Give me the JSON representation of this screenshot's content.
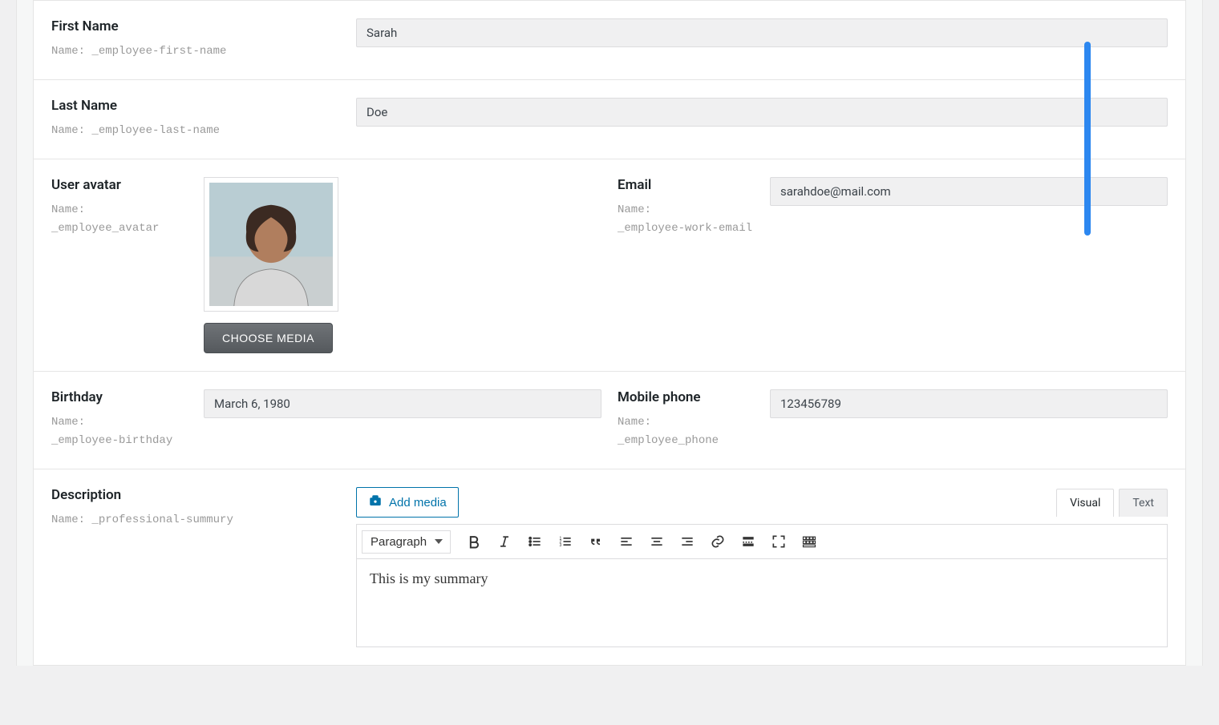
{
  "fields": {
    "firstName": {
      "label": "First Name",
      "namePrefix": "Name: ",
      "nameValue": "_employee-first-name",
      "value": "Sarah"
    },
    "lastName": {
      "label": "Last Name",
      "namePrefix": "Name: ",
      "nameValue": "_employee-last-name",
      "value": "Doe"
    },
    "avatar": {
      "label": "User avatar",
      "namePrefix": "Name:",
      "nameValue": "_employee_avatar",
      "button": "CHOOSE MEDIA"
    },
    "email": {
      "label": "Email",
      "namePrefix": "Name:",
      "nameValue": "_employee-work-email",
      "value": "sarahdoe@mail.com"
    },
    "birthday": {
      "label": "Birthday",
      "namePrefix": "Name:",
      "nameValue": "_employee-birthday",
      "value": "March 6, 1980"
    },
    "phone": {
      "label": "Mobile phone",
      "namePrefix": "Name:",
      "nameValue": "_employee_phone",
      "value": "123456789"
    },
    "description": {
      "label": "Description",
      "namePrefix": "Name: ",
      "nameValue": "_professional-summury",
      "addMedia": "Add media",
      "tabVisual": "Visual",
      "tabText": "Text",
      "formatSelect": "Paragraph",
      "content": "This is my summary"
    }
  }
}
